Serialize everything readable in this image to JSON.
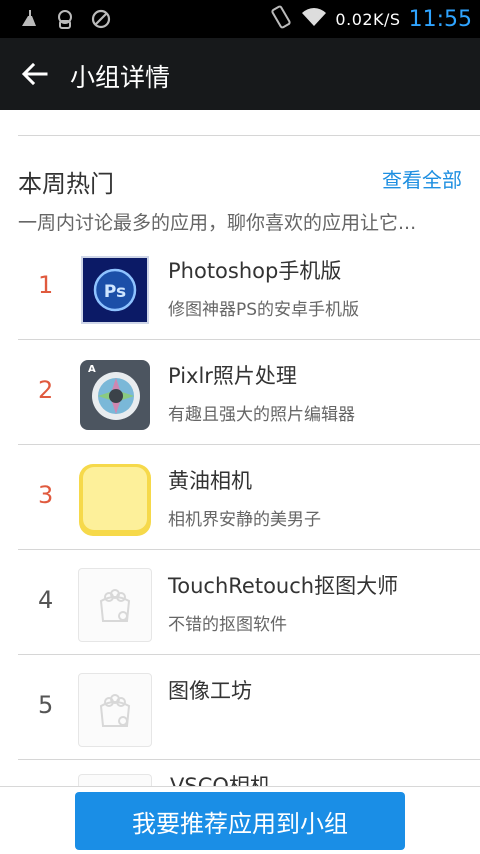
{
  "status_bar": {
    "net_speed": "0.02K/S",
    "time": "11:55"
  },
  "header": {
    "title": "小组详情"
  },
  "section": {
    "title": "本周热门",
    "see_all": "查看全部",
    "description": "一周内讨论最多的应用，聊你喜欢的应用让它..."
  },
  "apps": [
    {
      "rank": "1",
      "name": "Photoshop手机版",
      "desc": "修图神器PS的安卓手机版",
      "icon": "photoshop-icon"
    },
    {
      "rank": "2",
      "name": "Pixlr照片处理",
      "desc": "有趣且强大的照片编辑器",
      "icon": "pixlr-icon"
    },
    {
      "rank": "3",
      "name": "黄油相机",
      "desc": "相机界安静的美男子",
      "icon": "butter-camera-icon"
    },
    {
      "rank": "4",
      "name": "TouchRetouch抠图大师",
      "desc": "不错的抠图软件",
      "icon": "placeholder-icon"
    },
    {
      "rank": "5",
      "name": "图像工坊",
      "desc": "",
      "icon": "placeholder-icon"
    }
  ],
  "peek_item": {
    "name": "VSCO相机"
  },
  "bottom": {
    "button_label": "我要推荐应用到小组"
  },
  "colors": {
    "accent": "#1a8ee6",
    "hot_rank": "#e05a3e",
    "status_time": "#2fa4ff"
  }
}
